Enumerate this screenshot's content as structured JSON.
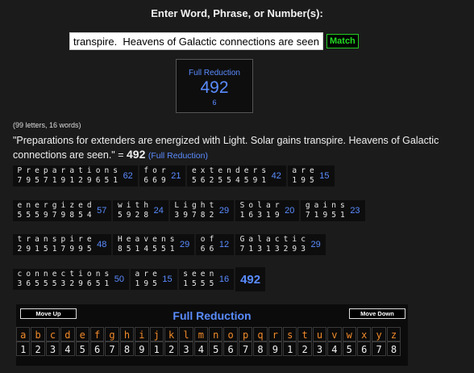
{
  "heading": "Enter Word, Phrase, or Number(s):",
  "input": {
    "value": "transpire.  Heavens of Galactic connections are seen."
  },
  "match_label": "Match",
  "summary": {
    "label": "Full Reduction",
    "value": "492",
    "sub": "6"
  },
  "counts": "(99 letters, 16 words)",
  "phrase": {
    "text": "\"Preparations for extenders are energized with Light. Solar gains transpire. Heavens of Galactic connections are seen.\" = ",
    "value": "492",
    "cipher": "(Full Reduction)"
  },
  "rows": [
    [
      {
        "letters": "Preparations",
        "nums": "795719129651",
        "value": "62"
      },
      {
        "letters": "for",
        "nums": "669",
        "value": "21"
      },
      {
        "letters": "extenders",
        "nums": "562554591",
        "value": "42"
      },
      {
        "letters": "are",
        "nums": "195",
        "value": "15"
      }
    ],
    [
      {
        "letters": "energized",
        "nums": "555979854",
        "value": "57"
      },
      {
        "letters": "with",
        "nums": "5928",
        "value": "24"
      },
      {
        "letters": "Light",
        "nums": "39782",
        "value": "29"
      },
      {
        "letters": "Solar",
        "nums": "16319",
        "value": "20"
      },
      {
        "letters": "gains",
        "nums": "71951",
        "value": "23"
      }
    ],
    [
      {
        "letters": "transpire",
        "nums": "291517995",
        "value": "48"
      },
      {
        "letters": "Heavens",
        "nums": "8514551",
        "value": "29"
      },
      {
        "letters": "of",
        "nums": "66",
        "value": "12"
      },
      {
        "letters": "Galactic",
        "nums": "71313293",
        "value": "29"
      }
    ],
    [
      {
        "letters": "connections",
        "nums": "36555329651",
        "value": "50"
      },
      {
        "letters": "are",
        "nums": "195",
        "value": "15"
      },
      {
        "letters": "seen",
        "nums": "1555",
        "value": "16"
      }
    ]
  ],
  "total": "492",
  "cipher_panel": {
    "move_up": "Move Up",
    "move_down": "Move Down",
    "title": "Full Reduction",
    "letters": [
      "a",
      "b",
      "c",
      "d",
      "e",
      "f",
      "g",
      "h",
      "i",
      "j",
      "k",
      "l",
      "m",
      "n",
      "o",
      "p",
      "q",
      "r",
      "s",
      "t",
      "u",
      "v",
      "w",
      "x",
      "y",
      "z"
    ],
    "numbers": [
      "1",
      "2",
      "3",
      "4",
      "5",
      "6",
      "7",
      "8",
      "9",
      "1",
      "2",
      "3",
      "4",
      "5",
      "6",
      "7",
      "8",
      "9",
      "1",
      "2",
      "3",
      "4",
      "5",
      "6",
      "7",
      "8"
    ]
  }
}
